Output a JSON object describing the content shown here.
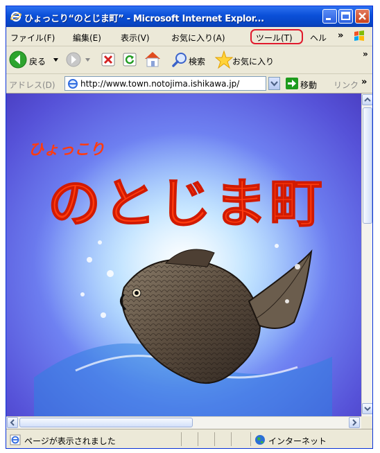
{
  "window": {
    "title": "ひょっこり“のとじま町” - Microsoft Internet Explor..."
  },
  "menu": {
    "items": [
      "ファイル(F)",
      "編集(E)",
      "表示(V)",
      "お気に入り(A)",
      "ツール(T)",
      "ヘル"
    ],
    "overflow": "»",
    "highlighted": "ツール(T)",
    "highlight_color": "#e0192c"
  },
  "toolbar": {
    "back_label": "戻る",
    "search_label": "検索",
    "favorites_label": "お気に入り"
  },
  "address": {
    "label": "アドレス(D)",
    "url": "http://www.town.notojima.ishikawa.jp/",
    "go_label": "移動",
    "links_label": "リンク",
    "overflow": "»"
  },
  "page": {
    "small_heading": "ひょっこり",
    "main_heading": "のとじま町",
    "heading_color": "#ff3c10"
  },
  "status": {
    "message": "ページが表示されました",
    "zone": "インターネット"
  },
  "icons": {
    "ie": "ie-logo-icon",
    "back": "back-arrow-icon",
    "forward": "forward-arrow-icon",
    "stop": "stop-icon",
    "refresh": "refresh-icon",
    "home": "home-icon",
    "search": "search-icon",
    "favorites": "star-icon",
    "go": "go-arrow-icon",
    "globe": "globe-icon"
  }
}
